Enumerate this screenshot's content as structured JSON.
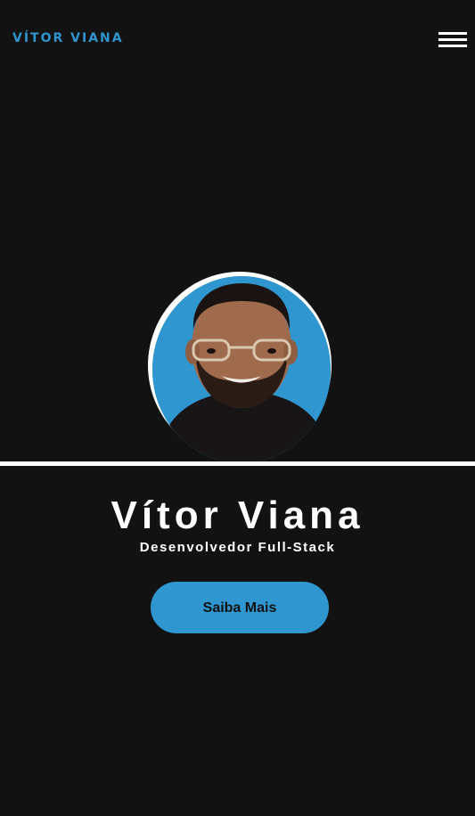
{
  "header": {
    "logo_text": "VÍTOR VIANA",
    "menu_icon": "hamburger-menu-icon"
  },
  "hero": {
    "photo_alt": "Vítor Viana",
    "name": "Vítor Viana",
    "role": "Desenvolvedor Full-Stack",
    "cta_label": "Saiba Mais"
  },
  "colors": {
    "background": "#121213",
    "accent": "#2f96cf",
    "text": "#ffffff",
    "button_text": "#111111"
  }
}
